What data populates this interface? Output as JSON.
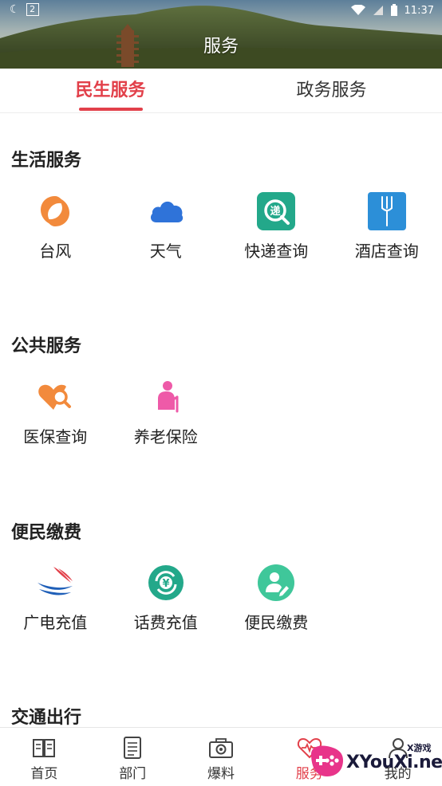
{
  "status_bar": {
    "time": "11:37",
    "notification_count": "2"
  },
  "page_title": "服务",
  "tabs": [
    {
      "label": "民生服务",
      "active": true
    },
    {
      "label": "政务服务",
      "active": false
    }
  ],
  "sections": [
    {
      "title": "生活服务",
      "items": [
        {
          "label": "台风",
          "icon": "typhoon-icon"
        },
        {
          "label": "天气",
          "icon": "cloud-icon"
        },
        {
          "label": "快递查询",
          "icon": "express-search-icon"
        },
        {
          "label": "酒店查询",
          "icon": "hotel-fork-icon"
        }
      ]
    },
    {
      "title": "公共服务",
      "items": [
        {
          "label": "医保查询",
          "icon": "medical-heart-search-icon"
        },
        {
          "label": "养老保险",
          "icon": "elderly-person-icon"
        }
      ]
    },
    {
      "title": "便民缴费",
      "items": [
        {
          "label": "广电充值",
          "icon": "broadcast-wing-icon"
        },
        {
          "label": "话费充值",
          "icon": "yuan-refresh-icon"
        },
        {
          "label": "便民缴费",
          "icon": "person-edit-icon"
        }
      ]
    },
    {
      "title": "交通出行",
      "items": []
    }
  ],
  "bottom_nav": [
    {
      "label": "首页",
      "icon": "book-icon",
      "active": false
    },
    {
      "label": "部门",
      "icon": "document-list-icon",
      "active": false
    },
    {
      "label": "爆料",
      "icon": "camera-icon",
      "active": false
    },
    {
      "label": "服务",
      "icon": "heart-pulse-icon",
      "active": true
    },
    {
      "label": "我的",
      "icon": "user-icon",
      "active": false
    }
  ],
  "watermark": {
    "text": "XYouXi.net",
    "small": "X游戏"
  },
  "colors": {
    "accent": "#e2404a",
    "orange": "#f28a3c",
    "blue": "#2f73d9",
    "teal": "#23a88a",
    "pink": "#ee5aa8"
  }
}
